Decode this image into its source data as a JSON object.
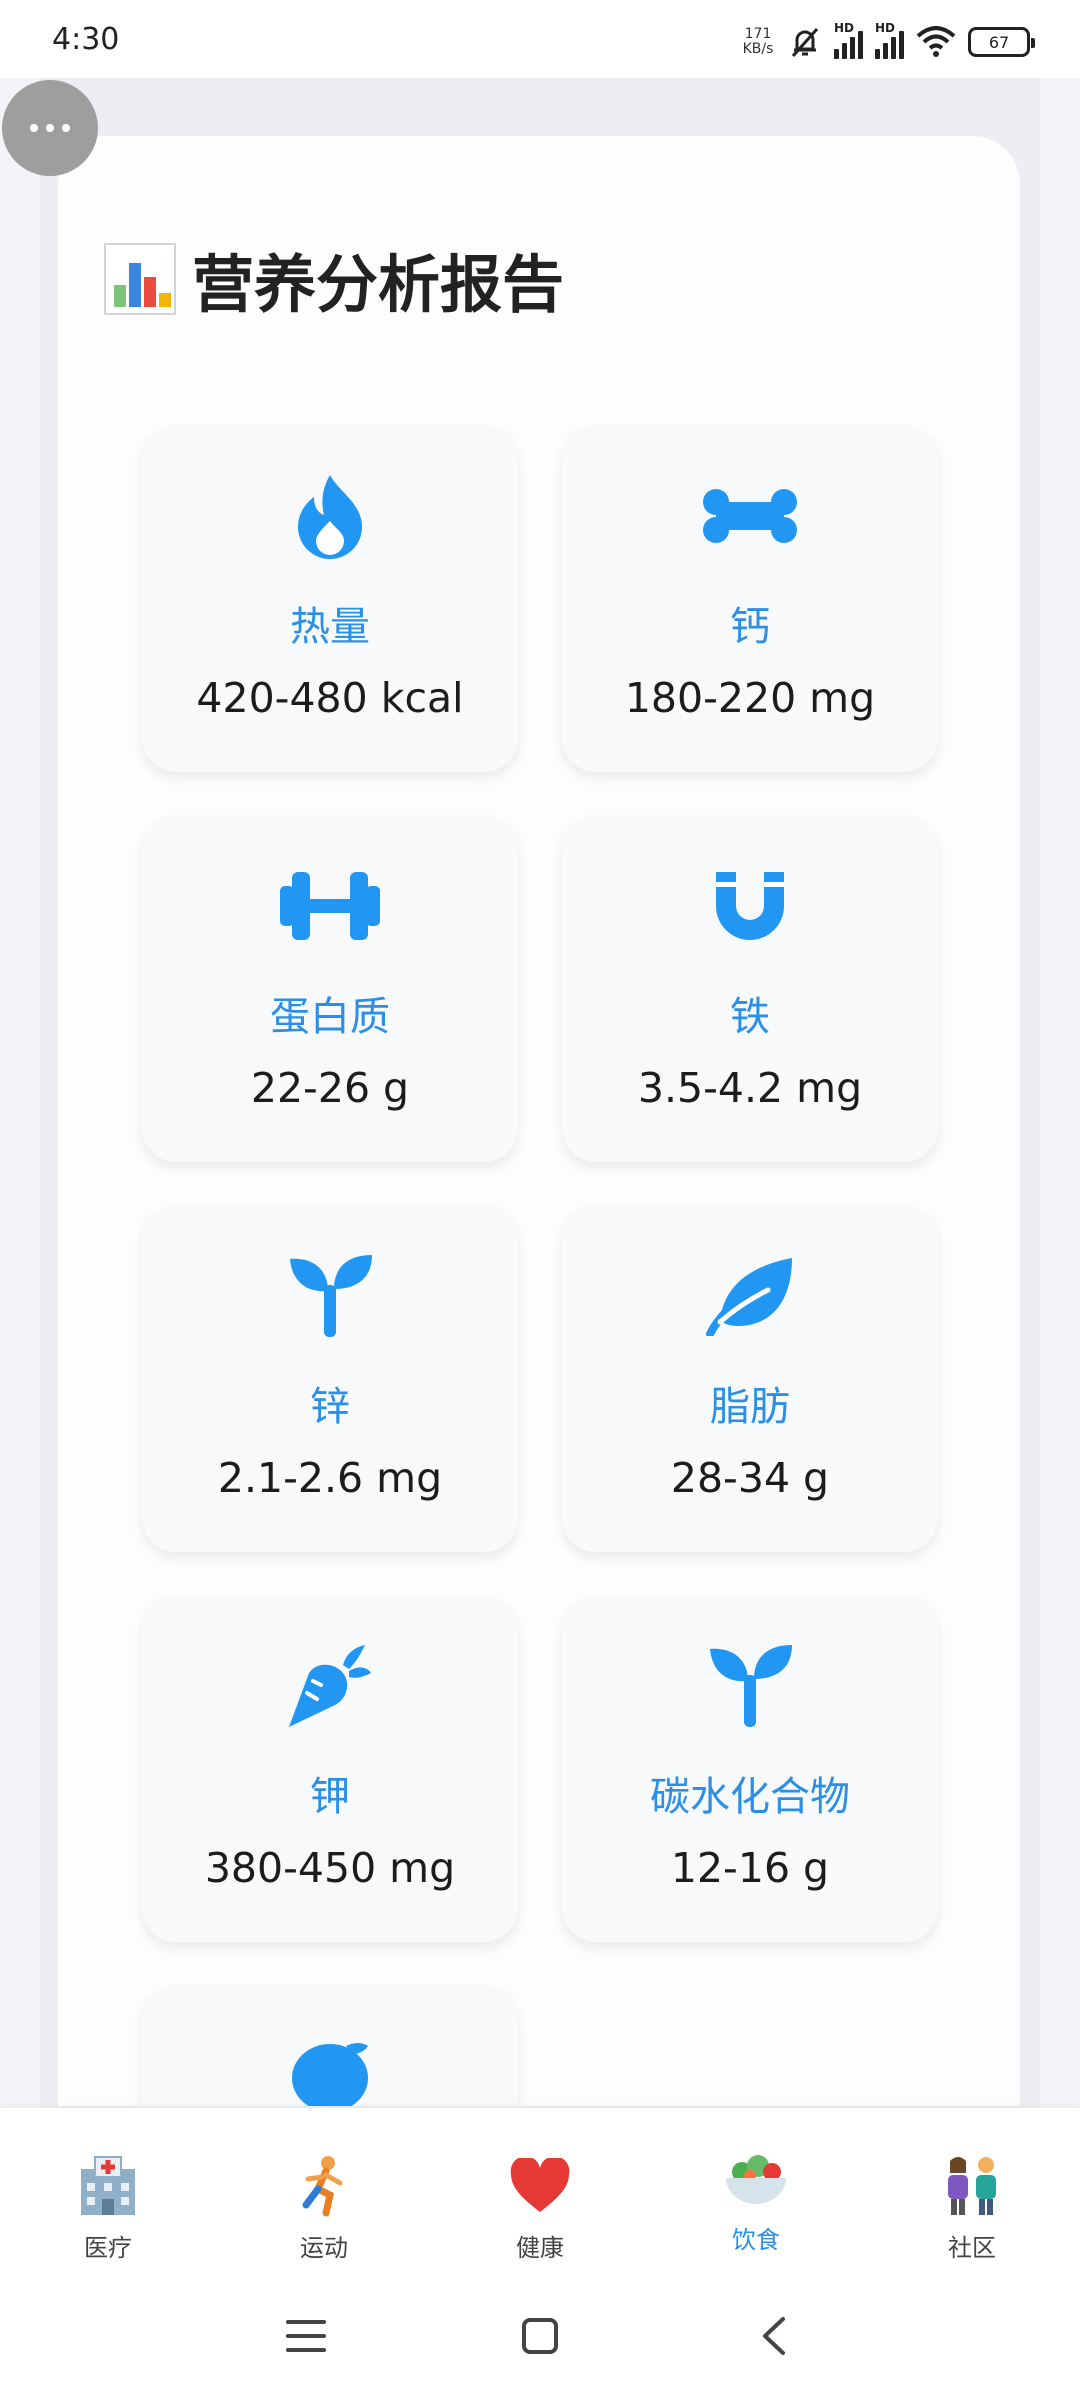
{
  "status": {
    "time": "4:30",
    "net_speed_value": "171",
    "net_speed_unit": "KB/s",
    "battery": "67",
    "hd1": "HD",
    "hd2": "HD"
  },
  "page": {
    "title": "营养分析报告"
  },
  "nutrients": [
    {
      "name": "热量",
      "value": "420-480 kcal",
      "icon": "fire-icon"
    },
    {
      "name": "钙",
      "value": "180-220 mg",
      "icon": "bone-icon"
    },
    {
      "name": "蛋白质",
      "value": "22-26 g",
      "icon": "dumbbell-icon"
    },
    {
      "name": "铁",
      "value": "3.5-4.2 mg",
      "icon": "magnet-icon"
    },
    {
      "name": "锌",
      "value": "2.1-2.6 mg",
      "icon": "seedling-icon"
    },
    {
      "name": "脂肪",
      "value": "28-34 g",
      "icon": "leaf-icon"
    },
    {
      "name": "钾",
      "value": "380-450 mg",
      "icon": "carrot-icon"
    },
    {
      "name": "碳水化合物",
      "value": "12-16 g",
      "icon": "seedling-icon"
    },
    {
      "name": "",
      "value": "",
      "icon": "lemon-icon"
    }
  ],
  "bottom_nav": [
    {
      "label": "医疗",
      "icon": "hospital-icon",
      "active": false
    },
    {
      "label": "运动",
      "icon": "runner-icon",
      "active": false
    },
    {
      "label": "健康",
      "icon": "heart-icon",
      "active": false
    },
    {
      "label": "饮食",
      "icon": "salad-icon",
      "active": true
    },
    {
      "label": "社区",
      "icon": "people-icon",
      "active": false
    }
  ],
  "colors": {
    "accent": "#2a8fe6",
    "icon_blue": "#2196f3",
    "tile_bg": "#f8f9fa",
    "page_bg": "#f3f4f7"
  }
}
